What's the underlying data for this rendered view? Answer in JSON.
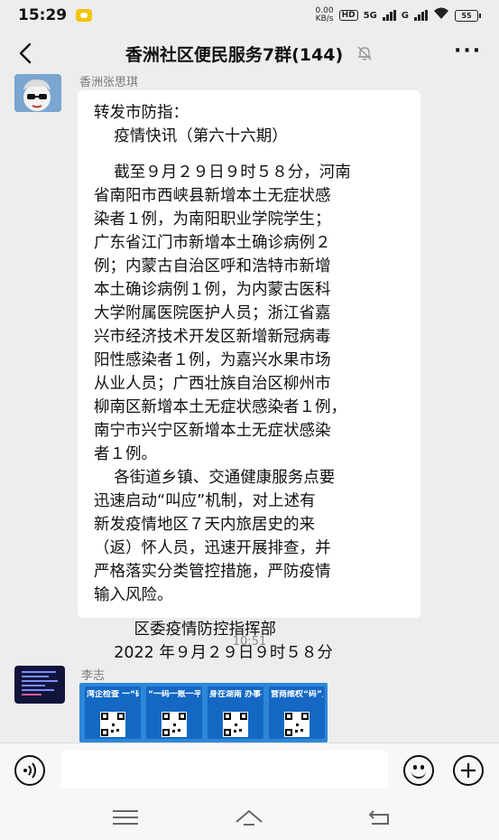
{
  "status_bar": {
    "time": "15:29",
    "net_speed_value": "0.00",
    "net_speed_unit": "KB/s",
    "hd_label": "HD",
    "signal1": "5G",
    "signal2": "G",
    "battery": "55"
  },
  "header": {
    "title": "香洲社区便民服务7群(144)",
    "more": "···"
  },
  "message1": {
    "sender": "香洲张思琪",
    "lines": [
      "转发市防指：",
      "    疫情快讯（第六十六期）",
      "",
      "    截至９月２９日９时５８分，河南",
      "省南阳市西峡县新增本土无症状感",
      "染者１例，为南阳职业学院学生；",
      "广东省江门市新增本土确诊病例２",
      "例；内蒙古自治区呼和浩特市新增",
      "本土确诊病例１例，为内蒙古医科",
      "大学附属医院医护人员；浙江省嘉",
      "兴市经济技术开发区新增新冠病毒",
      "阳性感染者１例，为嘉兴水果市场",
      "从业人员；广西壮族自治区柳州市",
      "柳南区新增本土无症状感染者１例，",
      "南宁市兴宁区新增本土无症状感染",
      "者１例。",
      "    各街道乡镇、交通健康服务点要",
      "迅速启动“叫应”机制，对上述有",
      "新发疫情地区７天内旅居史的来",
      "（返）怀人员，迅速开展排查，并",
      "严格落实分类管控措施，严防疫情",
      "输入风险。"
    ],
    "signature_org": "        区委疫情防控指挥部",
    "signature_date": "    2022 年９月２９日９时５８分"
  },
  "timestamp": "10:51",
  "message2": {
    "sender": "李志",
    "poster_cards": [
      "湾企检查 一“码”当先",
      "“一码一账一平台” 工作体系",
      "身在湖南 办事不难",
      "营商维权“码”上办"
    ]
  },
  "input_bar": {
    "placeholder": ""
  }
}
